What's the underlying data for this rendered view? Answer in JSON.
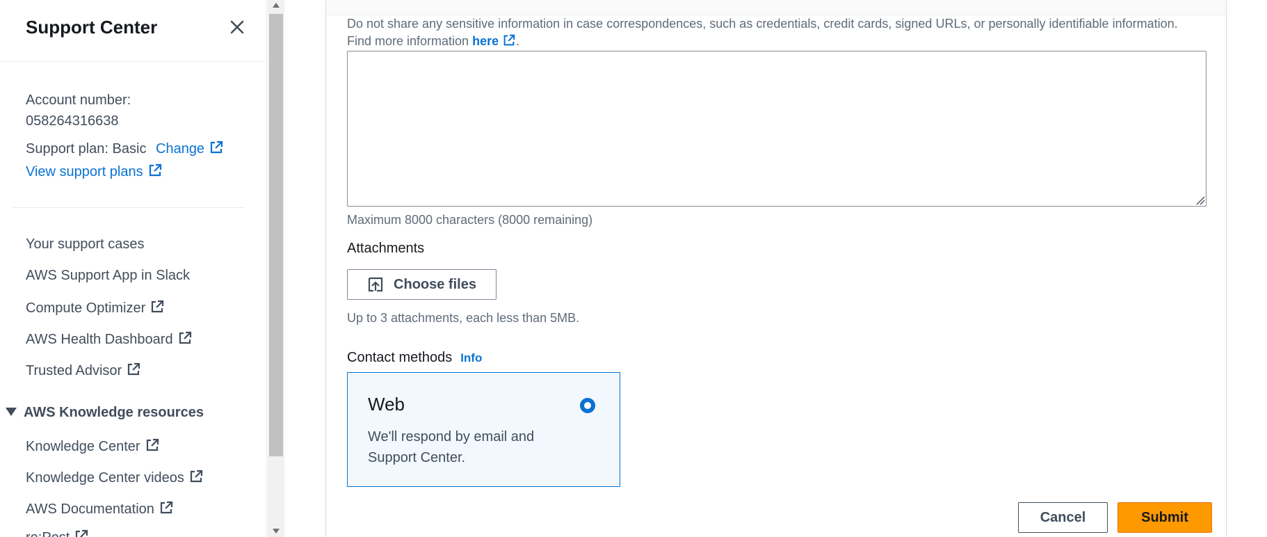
{
  "sidebar": {
    "title": "Support Center",
    "account_label": "Account number:",
    "account_number": "058264316638",
    "support_plan_label": "Support plan: Basic",
    "change_link": "Change",
    "view_plans_link": "View support plans",
    "nav": [
      {
        "label": "Your support cases",
        "external": false
      },
      {
        "label": "AWS Support App in Slack",
        "external": false
      },
      {
        "label": "Compute Optimizer",
        "external": true
      },
      {
        "label": "AWS Health Dashboard",
        "external": true
      },
      {
        "label": "Trusted Advisor",
        "external": true
      }
    ],
    "knowledge_section": {
      "title": "AWS Knowledge resources",
      "items": [
        {
          "label": "Knowledge Center",
          "external": true
        },
        {
          "label": "Knowledge Center videos",
          "external": true
        },
        {
          "label": "AWS Documentation",
          "external": true
        },
        {
          "label": "re:Post",
          "external": true
        }
      ]
    }
  },
  "form": {
    "warning_text": "Do not share any sensitive information in case correspondences, such as credentials, credit cards, signed URLs, or personally identifiable information.",
    "find_more_text": "Find more information",
    "find_more_link": "here",
    "find_more_suffix": ".",
    "description_value": "",
    "char_limit": "Maximum 8000 characters (8000 remaining)",
    "attachments_label": "Attachments",
    "choose_files_button": "Choose files",
    "attachments_hint": "Up to 3 attachments, each less than 5MB.",
    "contact_methods_label": "Contact methods",
    "info_link": "Info",
    "contact_option": {
      "title": "Web",
      "description": "We'll respond by email and Support Center.",
      "selected": true
    },
    "cancel_button": "Cancel",
    "submit_button": "Submit"
  },
  "colors": {
    "link": "#0972d3",
    "primary_button": "#ff9900",
    "selected_tile_bg": "#f2f8fd"
  }
}
